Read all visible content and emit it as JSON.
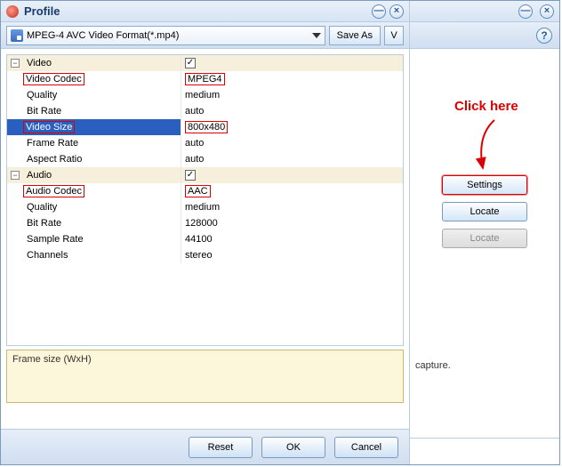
{
  "title": "Profile",
  "dropdown": {
    "selected": "MPEG-4 AVC Video Format(*.mp4)"
  },
  "toolbar": {
    "save_as": "Save As",
    "v": "V"
  },
  "groups": {
    "video": {
      "label": "Video",
      "checked": true,
      "rows": {
        "codec": {
          "label": "Video Codec",
          "value": "MPEG4"
        },
        "quality": {
          "label": "Quality",
          "value": "medium"
        },
        "bitrate": {
          "label": "Bit Rate",
          "value": "auto"
        },
        "size": {
          "label": "Video Size",
          "value": "800x480"
        },
        "framerate": {
          "label": "Frame Rate",
          "value": "auto"
        },
        "aspect": {
          "label": "Aspect Ratio",
          "value": "auto"
        }
      }
    },
    "audio": {
      "label": "Audio",
      "checked": true,
      "rows": {
        "codec": {
          "label": "Audio Codec",
          "value": "AAC"
        },
        "quality": {
          "label": "Quality",
          "value": "medium"
        },
        "bitrate": {
          "label": "Bit Rate",
          "value": "128000"
        },
        "samplerate": {
          "label": "Sample Rate",
          "value": "44100"
        },
        "channels": {
          "label": "Channels",
          "value": "stereo"
        }
      }
    }
  },
  "hint": "Frame size (WxH)",
  "buttons": {
    "reset": "Reset",
    "ok": "OK",
    "cancel": "Cancel"
  },
  "right": {
    "annotation": "Click here",
    "settings": "Settings",
    "locate1": "Locate",
    "locate2": "Locate",
    "capture": "capture."
  }
}
